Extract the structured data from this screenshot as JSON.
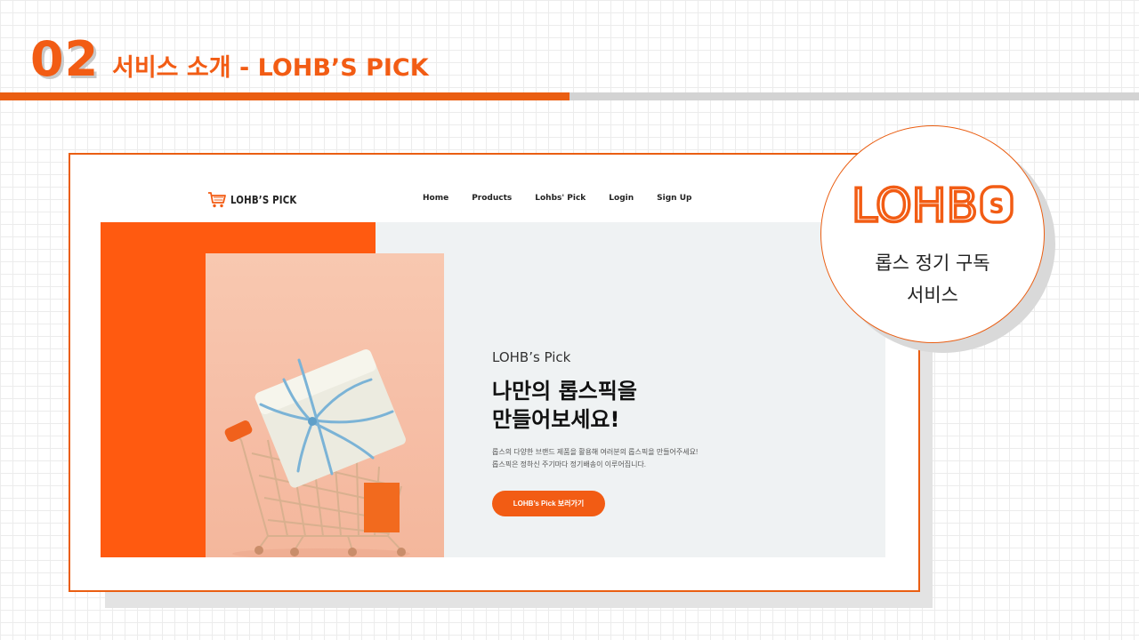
{
  "slide": {
    "number": "02",
    "title": "서비스 소개 - LOHB’S PICK"
  },
  "site": {
    "logo_text": "LOHB’S PICK",
    "nav": [
      "Home",
      "Products",
      "Lohbs' Pick",
      "Login",
      "Sign Up"
    ],
    "hero": {
      "brand": "LOHB’s Pick",
      "title_line1": "나만의 롭스픽을",
      "title_line2": "만들어보세요!",
      "desc_line1": "롭스의 다양한 브랜드 제품을 활용해 여러분의 롭스픽을 만들어주세요!",
      "desc_line2": "롭스픽은 정하신 주기마다 정기배송이 이루어집니다.",
      "button_label": "LOHB’s Pick 보러가기"
    }
  },
  "badge": {
    "logo_text": "LOHB",
    "logo_emblem": "S",
    "line1": "롭스 정기 구독",
    "line2": "서비스"
  },
  "colors": {
    "accent": "#f25c14",
    "hero_orange": "#ff5a10",
    "hero_bg": "#eff2f3",
    "photo_peach": "#f8c8b0",
    "gray_bar": "#d3d3d3"
  },
  "icons": {
    "site_logo": "shopping-cart-icon",
    "photo": "gift-in-shopping-cart-photo",
    "badge_emblem": "s-emblem-icon"
  }
}
